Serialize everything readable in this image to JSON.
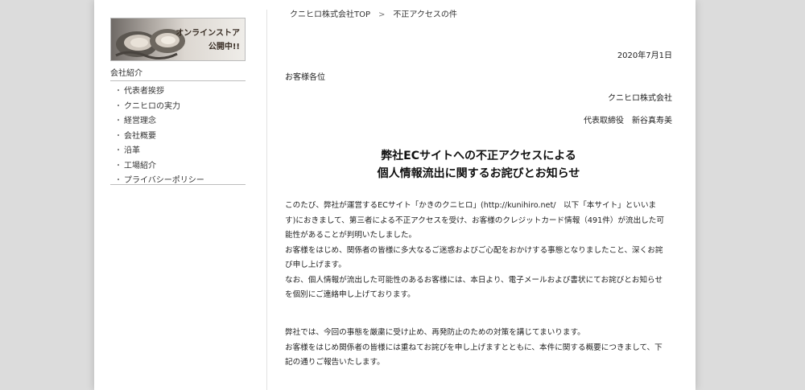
{
  "sidebar": {
    "banner": {
      "line1": "オンラインストア",
      "line2": "公開中!!"
    },
    "heading": "会社紹介",
    "items": [
      {
        "label": "代表者挨拶"
      },
      {
        "label": "クニヒロの実力"
      },
      {
        "label": "経営理念"
      },
      {
        "label": "会社概要"
      },
      {
        "label": "沿革"
      },
      {
        "label": "工場紹介"
      },
      {
        "label": "プライバシーポリシー"
      }
    ]
  },
  "breadcrumb": {
    "home": "クニヒロ株式会社TOP",
    "separator": ">",
    "current": "不正アクセスの件"
  },
  "notice": {
    "date": "2020年7月1日",
    "salutation": "お客様各位",
    "company": "クニヒロ株式会社",
    "representative": "代表取締役　新谷真寿美",
    "title_line1": "弊社ECサイトへの不正アクセスによる",
    "title_line2": "個人情報流出に関するお詫びとお知らせ",
    "para1": [
      "このたび、弊社が運営するECサイト「かきのクニヒロ」(http://kunihiro.net/　以下「本サイト」といいま",
      "す)におきまして、第三者による不正アクセスを受け、お客様のクレジットカード情報（491件）が流出した可",
      "能性があることが判明いたしました。",
      "お客様をはじめ、関係者の皆様に多大なるご迷惑およびご心配をおかけする事態となりましたこと、深くお詫",
      "び申し上げます。",
      "なお、個人情報が流出した可能性のあるお客様には、本日より、電子メールおよび書状にてお詫びとお知らせ",
      "を個別にご連絡申し上げております。"
    ],
    "para2": [
      "弊社では、今回の事態を厳粛に受け止め、再発防止のための対策を講じてまいります。",
      "お客様をはじめ関係者の皆様には重ねてお詫びを申し上げますとともに、本件に関する概要につきまして、下",
      "記の通りご報告いたします。"
    ]
  }
}
